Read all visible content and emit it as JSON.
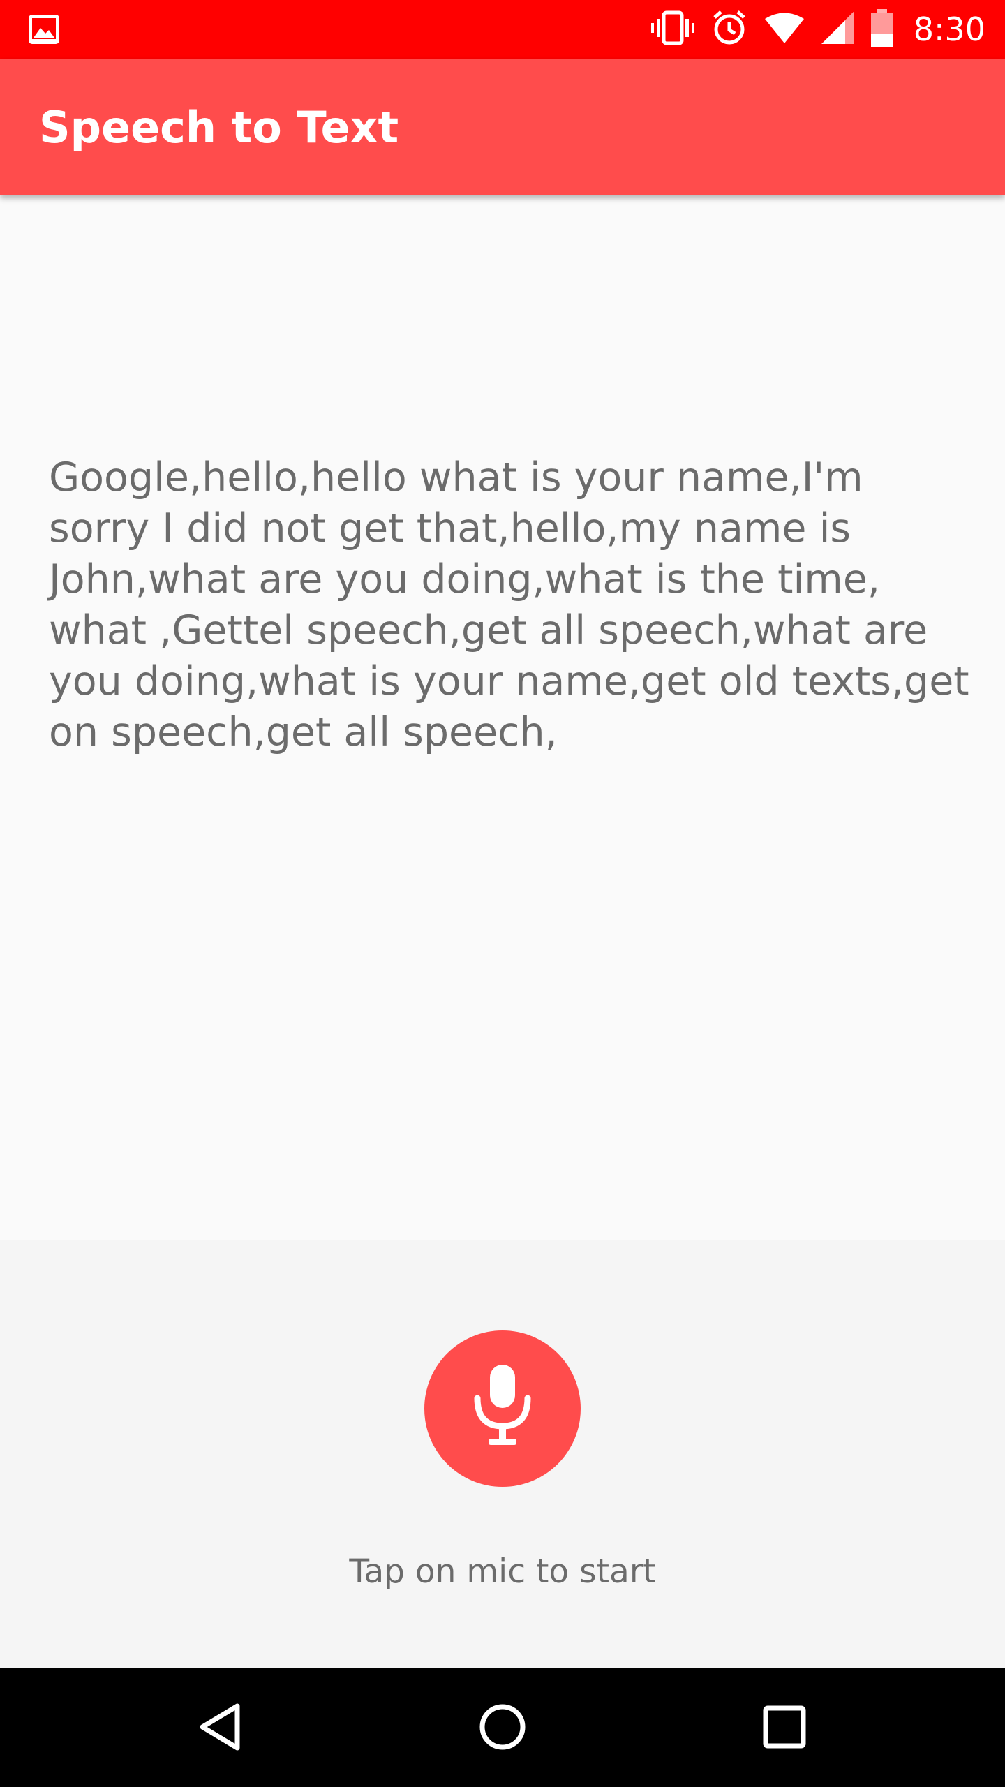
{
  "status_bar": {
    "time": "8:30",
    "color": "#ff0000",
    "icons": [
      "gallery-icon",
      "vibrate-icon",
      "alarm-icon",
      "wifi-icon",
      "signal-icon",
      "battery-icon"
    ]
  },
  "app_bar": {
    "title": "Speech to Text",
    "color": "#ff4c4c"
  },
  "main": {
    "transcript": "Google,hello,hello what is your name,I'm sorry I did not get that,hello,my name is John,what are you doing,what is the time, what ,Gettel speech,get all speech,what are you doing,what is your name,get old texts,get on speech,get all speech,"
  },
  "bottom_panel": {
    "mic_icon": "mic-icon",
    "mic_color": "#ff4c4c",
    "hint": "Tap on mic to start"
  },
  "nav_bar": {
    "icons": [
      "back-icon",
      "home-icon",
      "recents-icon"
    ]
  }
}
